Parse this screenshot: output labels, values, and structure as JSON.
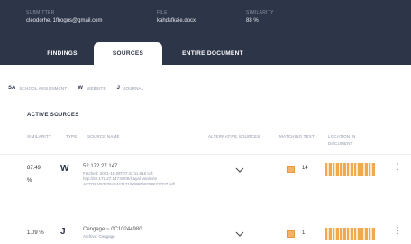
{
  "header": {
    "submitter_label": "SUBMITTER",
    "submitter_value": "cleodorhe. 1fbogus@gmail.com",
    "file_label": "FILE",
    "file_value": "kahdsfkaie.docx",
    "similarity_label": "SIMILARITY",
    "similarity_value": "88 %"
  },
  "tabs": [
    {
      "label": "FINDINGS"
    },
    {
      "label": "SOURCES"
    },
    {
      "label": "ENTIRE DOCUMENT"
    }
  ],
  "legend": [
    {
      "mark": "SA",
      "label": "SCHOOL ASSIGNMENT"
    },
    {
      "mark": "W",
      "label": "WEBSITE"
    },
    {
      "mark": "J",
      "label": "JOURNAL"
    }
  ],
  "section_title": "ACTIVE SOURCES",
  "columns": {
    "similarity": "SIMILARITY",
    "type": "TYPE",
    "source_name": "SOURCE NAME",
    "alt_sources": "ALTERNATIVE SOURCES",
    "matching_text": "MATCHING TEXT",
    "location": "LOCATION IN DOCUMENT"
  },
  "rows": [
    {
      "similarity": "87.49",
      "similarity_unit": "%",
      "type": "W",
      "name": "52.172.27.147",
      "detail": "Fetched: 2021-11-29T07:43:11.616 Url: http://52.172.27.147:8000/Saya/ Vardene ACTOR/452676c2443171/9099059768621/337.pdf",
      "matching": "14",
      "location_fill": 1.0
    },
    {
      "similarity": "1.09 %",
      "type": "J",
      "name": "Cengage ~ 0C10244980",
      "detail": "Archive: Cengage",
      "matching": "1",
      "location_fill": 1.0
    }
  ],
  "colors": {
    "header_bg": "#2d3548",
    "match_orange": "#f2a94e",
    "bar_bg": "#fce6c8"
  },
  "icons": {
    "alt_expand": "chevron-down-icon",
    "row_menu": "kebab-icon",
    "matching": "highlight-icon"
  }
}
